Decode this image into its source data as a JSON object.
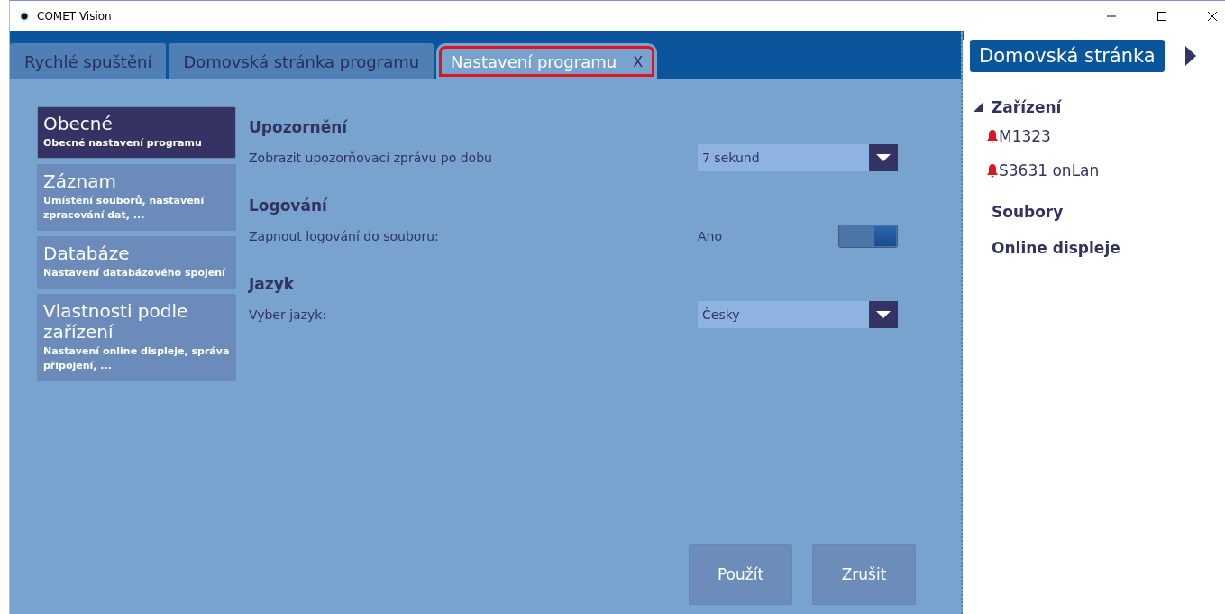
{
  "window": {
    "title": "COMET Vision"
  },
  "tabs": [
    {
      "label": "Rychlé spuštění",
      "selected": false,
      "highlighted": false
    },
    {
      "label": "Domovská stránka programu",
      "selected": false,
      "highlighted": false
    },
    {
      "label": "Nastavení programu",
      "selected": true,
      "close_label": "X",
      "highlighted": true
    }
  ],
  "categories": [
    {
      "title": "Obecné",
      "subtitle": "Obecné nastavení programu",
      "selected": true
    },
    {
      "title": "Záznam",
      "subtitle": "Umístění souborů, nastavení zpracování dat, ...",
      "selected": false
    },
    {
      "title": "Databáze",
      "subtitle": "Nastavení databázového spojení",
      "selected": false
    },
    {
      "title": "Vlastnosti podle zařízení",
      "subtitle": "Nastavení online displeje, správa připojení, ...",
      "selected": false
    }
  ],
  "sections": [
    {
      "heading": "Upozornění",
      "label": "Zobrazit upozorňovací zprávu po dobu",
      "kind": "select",
      "value": "7 sekund"
    },
    {
      "heading": "Logování",
      "label": "Zapnout logování do souboru:",
      "kind": "toggle",
      "value": "Ano",
      "on": true
    },
    {
      "heading": "Jazyk",
      "label": "Vyber jazyk:",
      "kind": "select",
      "value": "Česky"
    }
  ],
  "buttons": [
    "Použít",
    "Zrušit"
  ],
  "sidebar": {
    "title": "Domovská stránka",
    "items": [
      {
        "label": "Zařízení",
        "expanded": true,
        "children": [
          {
            "label": "M1323",
            "alarm": true
          },
          {
            "label": "S3631 onLan",
            "alarm": true
          }
        ]
      },
      {
        "label": "Soubory"
      },
      {
        "label": "Online displeje"
      }
    ]
  }
}
